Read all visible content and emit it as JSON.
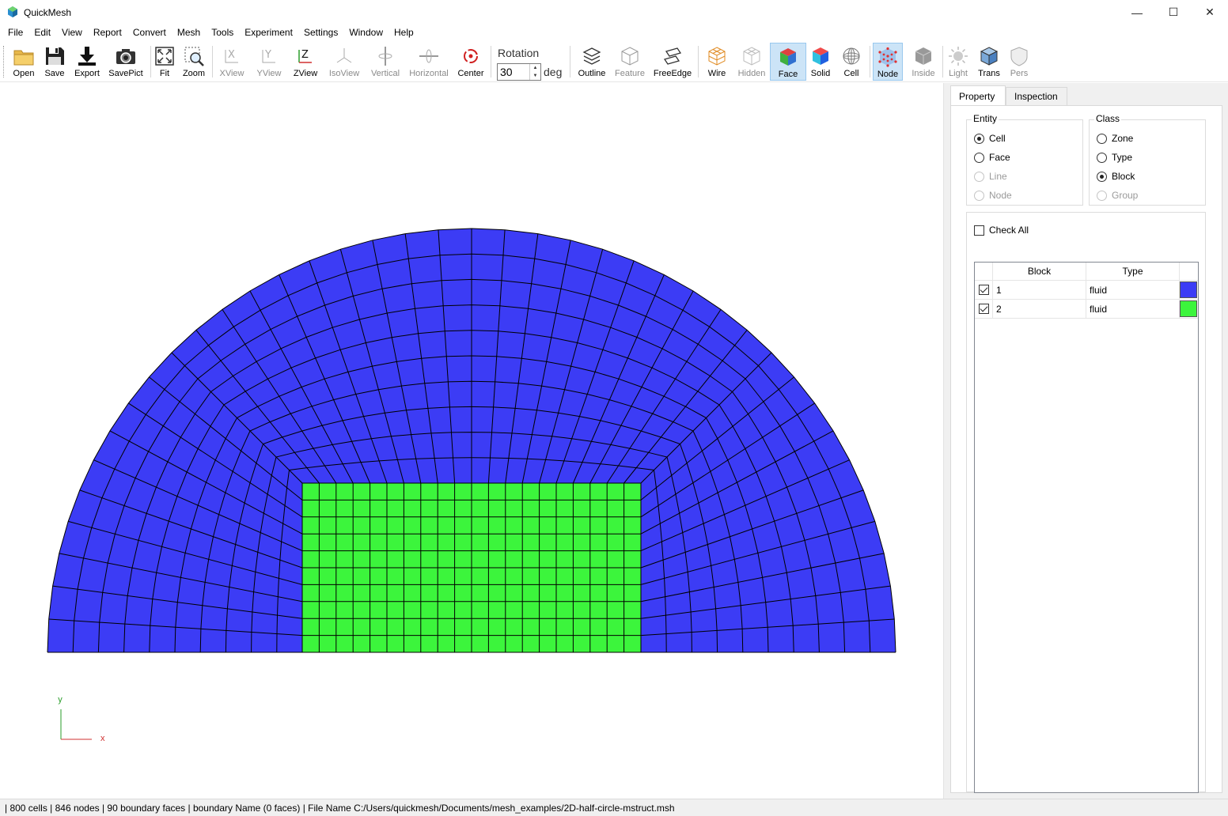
{
  "window": {
    "title": "QuickMesh",
    "minimize": "—",
    "maximize": "☐",
    "close": "✕"
  },
  "menu": [
    "File",
    "Edit",
    "View",
    "Report",
    "Convert",
    "Mesh",
    "Tools",
    "Experiment",
    "Settings",
    "Window",
    "Help"
  ],
  "toolbar": {
    "open": "Open",
    "save": "Save",
    "export": "Export",
    "savepict": "SavePict",
    "fit": "Fit",
    "zoom": "Zoom",
    "xview": "XView",
    "yview": "YView",
    "zview": "ZView",
    "isoview": "IsoView",
    "vertical": "Vertical",
    "horizontal": "Horizontal",
    "center": "Center",
    "rotation_label": "Rotation",
    "rotation_value": "30",
    "rotation_unit": "deg",
    "outline": "Outline",
    "feature": "Feature",
    "freeedge": "FreeEdge",
    "wire": "Wire",
    "hidden": "Hidden",
    "face": "Face",
    "solid": "Solid",
    "cell": "Cell",
    "node": "Node",
    "inside": "Inside",
    "light": "Light",
    "trans": "Trans",
    "pers": "Pers"
  },
  "viewport": {
    "axis_y": "y",
    "axis_x": "x",
    "colors": {
      "block1": "#3c3cf5",
      "block2": "#3cf53c",
      "grid": "#000000"
    }
  },
  "panel": {
    "tabs": [
      "Property",
      "Inspection"
    ],
    "entity": {
      "label": "Entity",
      "options": [
        {
          "label": "Cell",
          "checked": true,
          "enabled": true
        },
        {
          "label": "Face",
          "checked": false,
          "enabled": true
        },
        {
          "label": "Line",
          "checked": false,
          "enabled": false
        },
        {
          "label": "Node",
          "checked": false,
          "enabled": false
        }
      ]
    },
    "class": {
      "label": "Class",
      "options": [
        {
          "label": "Zone",
          "checked": false,
          "enabled": true
        },
        {
          "label": "Type",
          "checked": false,
          "enabled": true
        },
        {
          "label": "Block",
          "checked": true,
          "enabled": true
        },
        {
          "label": "Group",
          "checked": false,
          "enabled": false
        }
      ]
    },
    "check_all": "Check All",
    "table": {
      "headers": [
        "Block",
        "Type"
      ],
      "rows": [
        {
          "block": "1",
          "type": "fluid",
          "checked": true,
          "color": "#3c3cf5"
        },
        {
          "block": "2",
          "type": "fluid",
          "checked": true,
          "color": "#3cf53c"
        }
      ]
    }
  },
  "status": {
    "text": "| 800 cells | 846 nodes | 90 boundary faces |  boundary Name  (0 faces) | File Name C:/Users/quickmesh/Documents/mesh_examples/2D-half-circle-mstruct.msh"
  }
}
